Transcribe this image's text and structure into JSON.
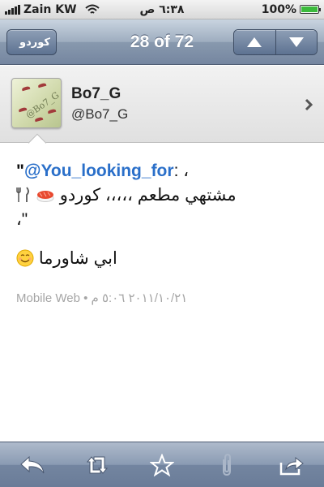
{
  "status_bar": {
    "carrier": "Zain KW",
    "time": "٦:٣٨ ص",
    "battery_percent": "100%",
    "battery_level": 1.0
  },
  "nav": {
    "back_label": "كوردو",
    "title": "28 of 72",
    "up_icon": "up-arrow-icon",
    "down_icon": "down-arrow-icon"
  },
  "profile": {
    "name": "Bo7_G",
    "handle": "@Bo7_G",
    "avatar_text": "@Bo7_G"
  },
  "tweet": {
    "open_quote": "\"",
    "mention": "@You_looking_for",
    "after_mention": ": ،",
    "line2_text": "مشتهي مطعم ،،،،، كوردو",
    "line3_text": "،\"",
    "line4_text": "ابي شاورما",
    "meta": "Mobile Web • ٢٠١١/١٠/٢١ ٥:٠٦ م"
  },
  "toolbar": {
    "items": [
      "reply-icon",
      "retweet-icon",
      "star-icon",
      "attachment-icon",
      "share-icon"
    ]
  },
  "colors": {
    "mention": "#2a6fc9",
    "nav_bar": "#8899ae",
    "meta_text": "#a5a5a5"
  }
}
